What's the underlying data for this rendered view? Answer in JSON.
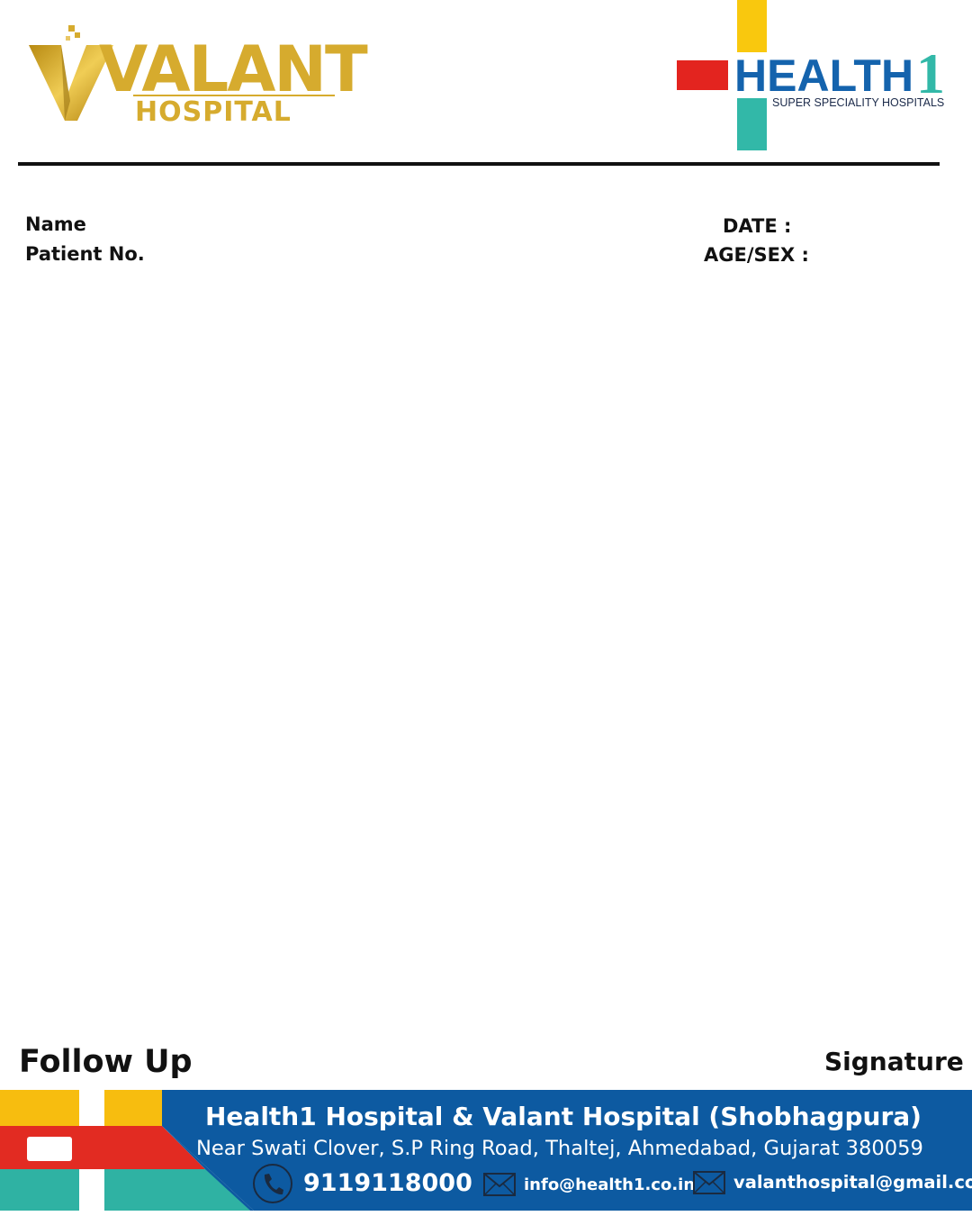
{
  "header": {
    "valant_logo": {
      "word": "VALANT",
      "sub": "HOSPITAL"
    },
    "health1_logo": {
      "word": "HEALTH",
      "number": "1",
      "tagline": "SUPER SPECIALITY HOSPITALS"
    }
  },
  "patient_fields": {
    "name_label": "Name",
    "patient_no_label": "Patient No.",
    "date_label": "DATE :",
    "age_sex_label": "AGE/SEX :"
  },
  "footer_labels": {
    "follow_up": "Follow Up",
    "signature": "Signature"
  },
  "footer_band": {
    "title": "Health1 Hospital & Valant Hospital (Shobhagpura)",
    "address": "Near Swati Clover, S.P Ring Road, Thaltej, Ahmedabad, Gujarat 380059",
    "phone": "9119118000",
    "email_1": "info@health1.co.in",
    "email_2": "valanthospital@gmail.com"
  },
  "colors": {
    "gold": "#d6ab2e",
    "health1_blue": "#1463ad",
    "health1_red": "#e3241f",
    "health1_yellow": "#f9c80e",
    "health1_teal": "#32b8a8",
    "footer_blue": "#0d5aa1",
    "footer_yellow": "#f7bd0f",
    "footer_red": "#e22b22",
    "footer_teal": "#2fb2a3"
  },
  "icons": [
    "valant-v-icon",
    "plus-cross-icon",
    "phone-icon",
    "mail-icon"
  ]
}
